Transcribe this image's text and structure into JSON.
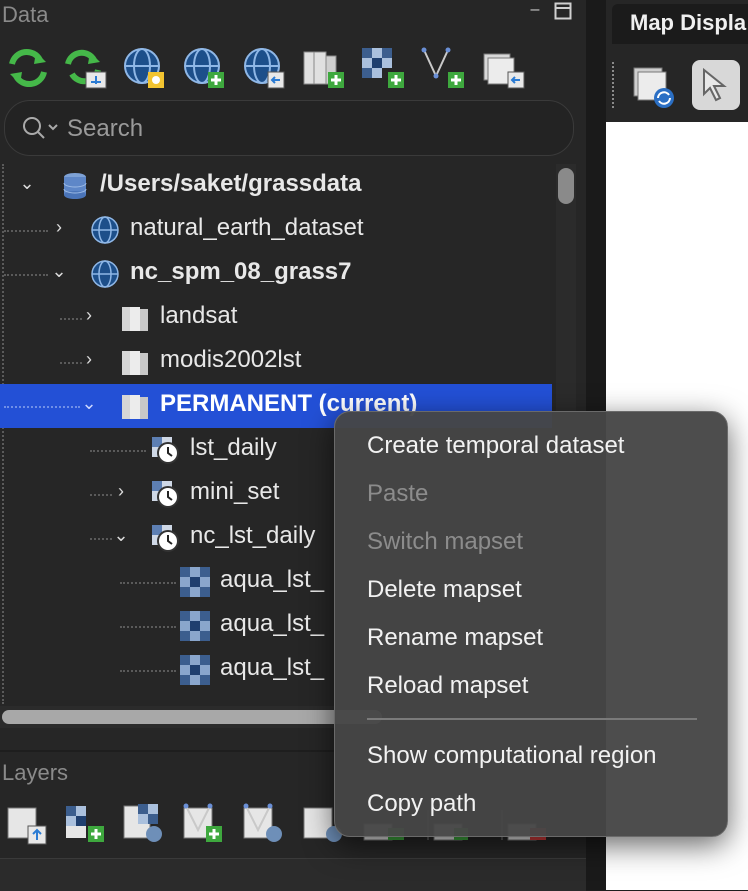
{
  "data_panel": {
    "title": "Data",
    "search": {
      "placeholder": "Search",
      "value": ""
    },
    "toolbar_icons": [
      "reload-icon",
      "reload-current-mapset-icon",
      "new-location-icon",
      "new-location-wizard-icon",
      "import-location-icon",
      "new-mapset-icon",
      "import-raster-icon",
      "import-vector-icon",
      "link-external-data-icon"
    ],
    "tree": {
      "rows": [
        {
          "label": "/Users/saket/grassdata",
          "type": "grassdb",
          "expanded": true
        },
        {
          "label": "natural_earth_dataset",
          "type": "location",
          "expanded": false
        },
        {
          "label": "nc_spm_08_grass7",
          "type": "location",
          "expanded": true
        },
        {
          "label": "landsat",
          "type": "mapset",
          "expanded": false
        },
        {
          "label": "modis2002lst",
          "type": "mapset",
          "expanded": false
        },
        {
          "label": "PERMANENT  (current)",
          "type": "mapset",
          "expanded": true,
          "selected": true
        },
        {
          "label": "lst_daily",
          "type": "strds"
        },
        {
          "label": "mini_set",
          "type": "strds",
          "expanded": false
        },
        {
          "label": "nc_lst_daily",
          "type": "strds",
          "expanded": true
        },
        {
          "label": "aqua_lst_",
          "type": "raster"
        },
        {
          "label": "aqua_lst_",
          "type": "raster"
        },
        {
          "label": "aqua_lst_",
          "type": "raster"
        }
      ]
    }
  },
  "layers_panel": {
    "title": "Layers",
    "toolbar_icons": [
      "add-raster-icon",
      "add-multiple-raster-icon",
      "add-overlay-raster-icon",
      "add-vector-icon",
      "add-overlay-vector-icon",
      "add-group-icon",
      "add-misc-icon",
      "add-web-layer-icon",
      "remove-layer-icon"
    ]
  },
  "map_display": {
    "tab_label": "Map Displa",
    "toolbar_icons": [
      "render-map-icon",
      "pointer-icon"
    ]
  },
  "context_menu": {
    "items": [
      {
        "label": "Create temporal dataset",
        "enabled": true
      },
      {
        "label": "Paste",
        "enabled": false
      },
      {
        "label": "Switch mapset",
        "enabled": false
      },
      {
        "label": "Delete mapset",
        "enabled": true
      },
      {
        "label": "Rename mapset",
        "enabled": true
      },
      {
        "label": "Reload mapset",
        "enabled": true
      },
      {
        "label": "Show computational region",
        "enabled": true
      },
      {
        "label": "Copy path",
        "enabled": true
      }
    ]
  },
  "colors": {
    "selection": "#2350d6",
    "panel_bg": "#262626",
    "menu_bg": "#464646"
  }
}
